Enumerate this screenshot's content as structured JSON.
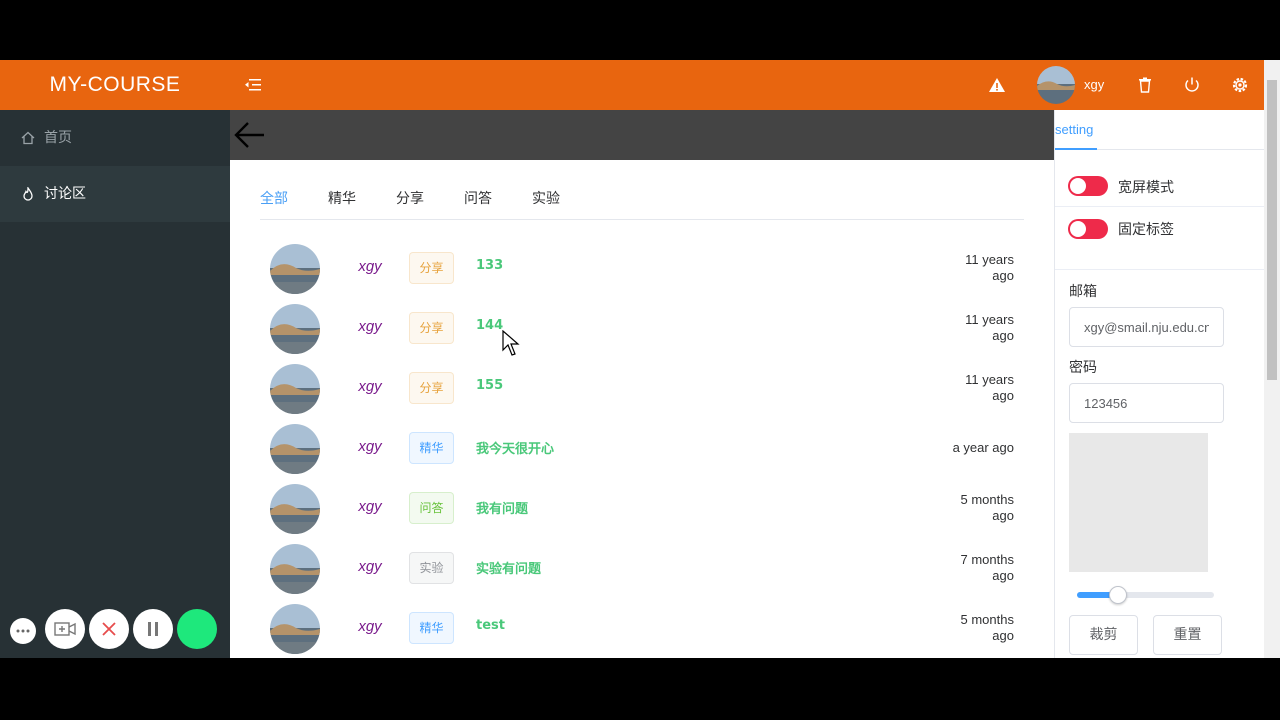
{
  "header": {
    "logo": "MY-COURSE",
    "username": "xgy",
    "icons": [
      "collapse-icon",
      "warning-icon",
      "trash-icon",
      "power-icon",
      "gear-icon"
    ],
    "accent_color": "#e8650f"
  },
  "sidebar": {
    "items": [
      {
        "label": "首页",
        "icon": "home-icon"
      },
      {
        "label": "讨论区",
        "icon": "flame-icon"
      }
    ]
  },
  "tabs": [
    {
      "label": "全部",
      "active": true
    },
    {
      "label": "精华",
      "active": false
    },
    {
      "label": "分享",
      "active": false
    },
    {
      "label": "问答",
      "active": false
    },
    {
      "label": "实验",
      "active": false
    }
  ],
  "posts": [
    {
      "user": "xgy",
      "tag": "分享",
      "tag_color": "#e6a23c",
      "title": "133",
      "time_line1": "11 years",
      "time_line2": "ago"
    },
    {
      "user": "xgy",
      "tag": "分享",
      "tag_color": "#e6a23c",
      "title": "144",
      "time_line1": "11 years",
      "time_line2": "ago"
    },
    {
      "user": "xgy",
      "tag": "分享",
      "tag_color": "#e6a23c",
      "title": "155",
      "time_line1": "11 years",
      "time_line2": "ago"
    },
    {
      "user": "xgy",
      "tag": "精华",
      "tag_color": "#409eff",
      "title": "我今天很开心",
      "time_line1": "a year ago",
      "time_line2": ""
    },
    {
      "user": "xgy",
      "tag": "问答",
      "tag_color": "#67c23a",
      "title": "我有问题",
      "time_line1": "5 months",
      "time_line2": "ago"
    },
    {
      "user": "xgy",
      "tag": "实验",
      "tag_color": "#909399",
      "title": "实验有问题",
      "time_line1": "7 months",
      "time_line2": "ago"
    },
    {
      "user": "xgy",
      "tag": "精华",
      "tag_color": "#409eff",
      "title": "test",
      "time_line1": "5 months",
      "time_line2": "ago"
    }
  ],
  "settings": {
    "tab_label": "setting",
    "switch_wide": {
      "label": "宽屏模式",
      "on": true
    },
    "switch_fixed_tags": {
      "label": "固定标签",
      "on": true
    },
    "email_label": "邮箱",
    "email_value": "xgy@smail.nju.edu.cn",
    "password_label": "密码",
    "password_value": "123456",
    "slider_value": 0.3,
    "crop_button": "裁剪",
    "reset_button": "重置"
  },
  "recorder_controls": [
    "more-icon",
    "camera-icon",
    "close-icon",
    "pause-icon",
    "record-indicator"
  ]
}
